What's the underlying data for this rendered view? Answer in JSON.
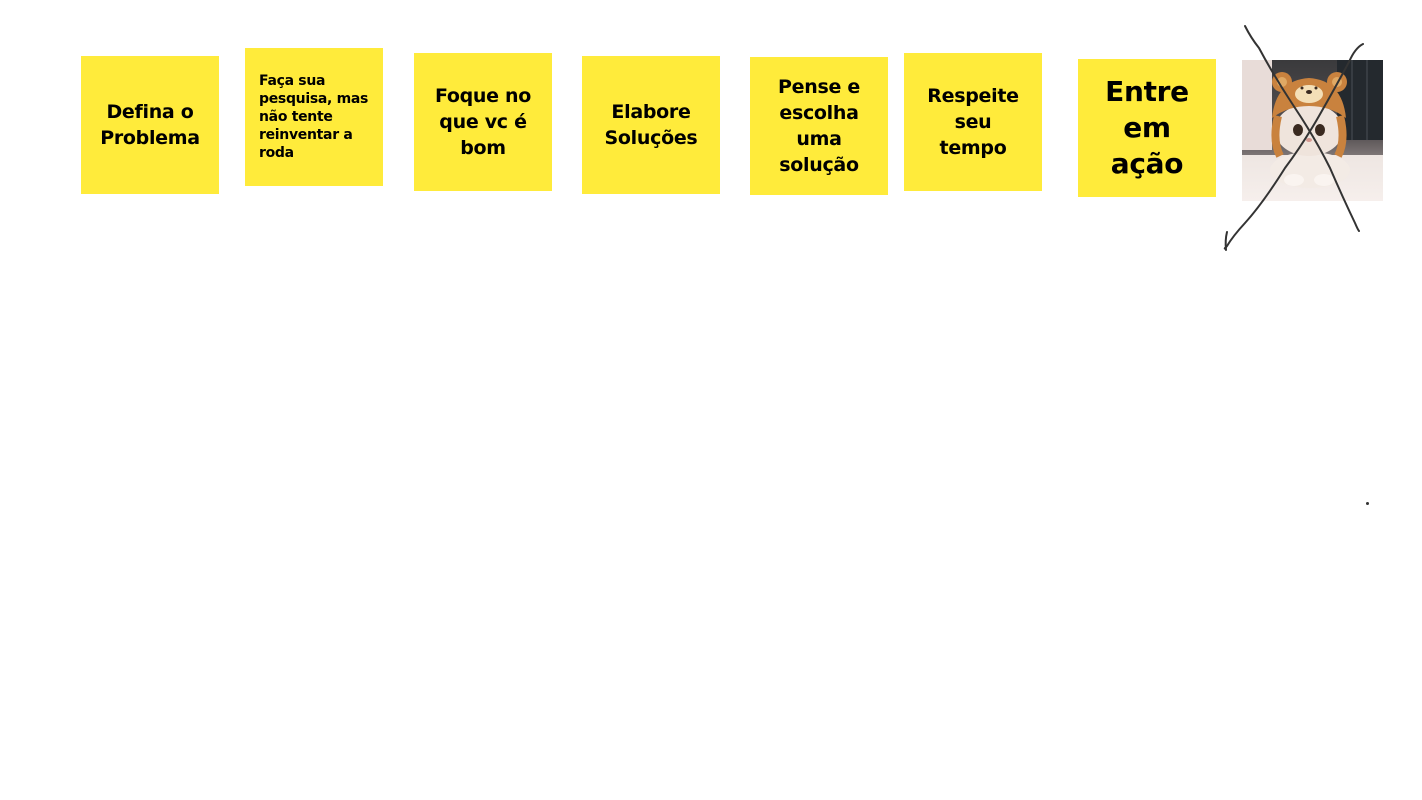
{
  "board": {
    "note_color": "#ffeb3b",
    "notes": [
      {
        "text": "Defina o\nProblema"
      },
      {
        "text": "Faça sua pesquisa, mas não tente reinventar a roda"
      },
      {
        "text": "Foque no\nque vc é\nbom"
      },
      {
        "text": "Elabore\nSoluções"
      },
      {
        "text": "Pense e\nescolha\numa\nsolução"
      },
      {
        "text": "Respeite\nseu\ntempo"
      },
      {
        "text": "Entre\nem\nação"
      }
    ],
    "photo": {
      "subject": "cat-in-bear-hat",
      "annotation": "crossed-out"
    }
  }
}
